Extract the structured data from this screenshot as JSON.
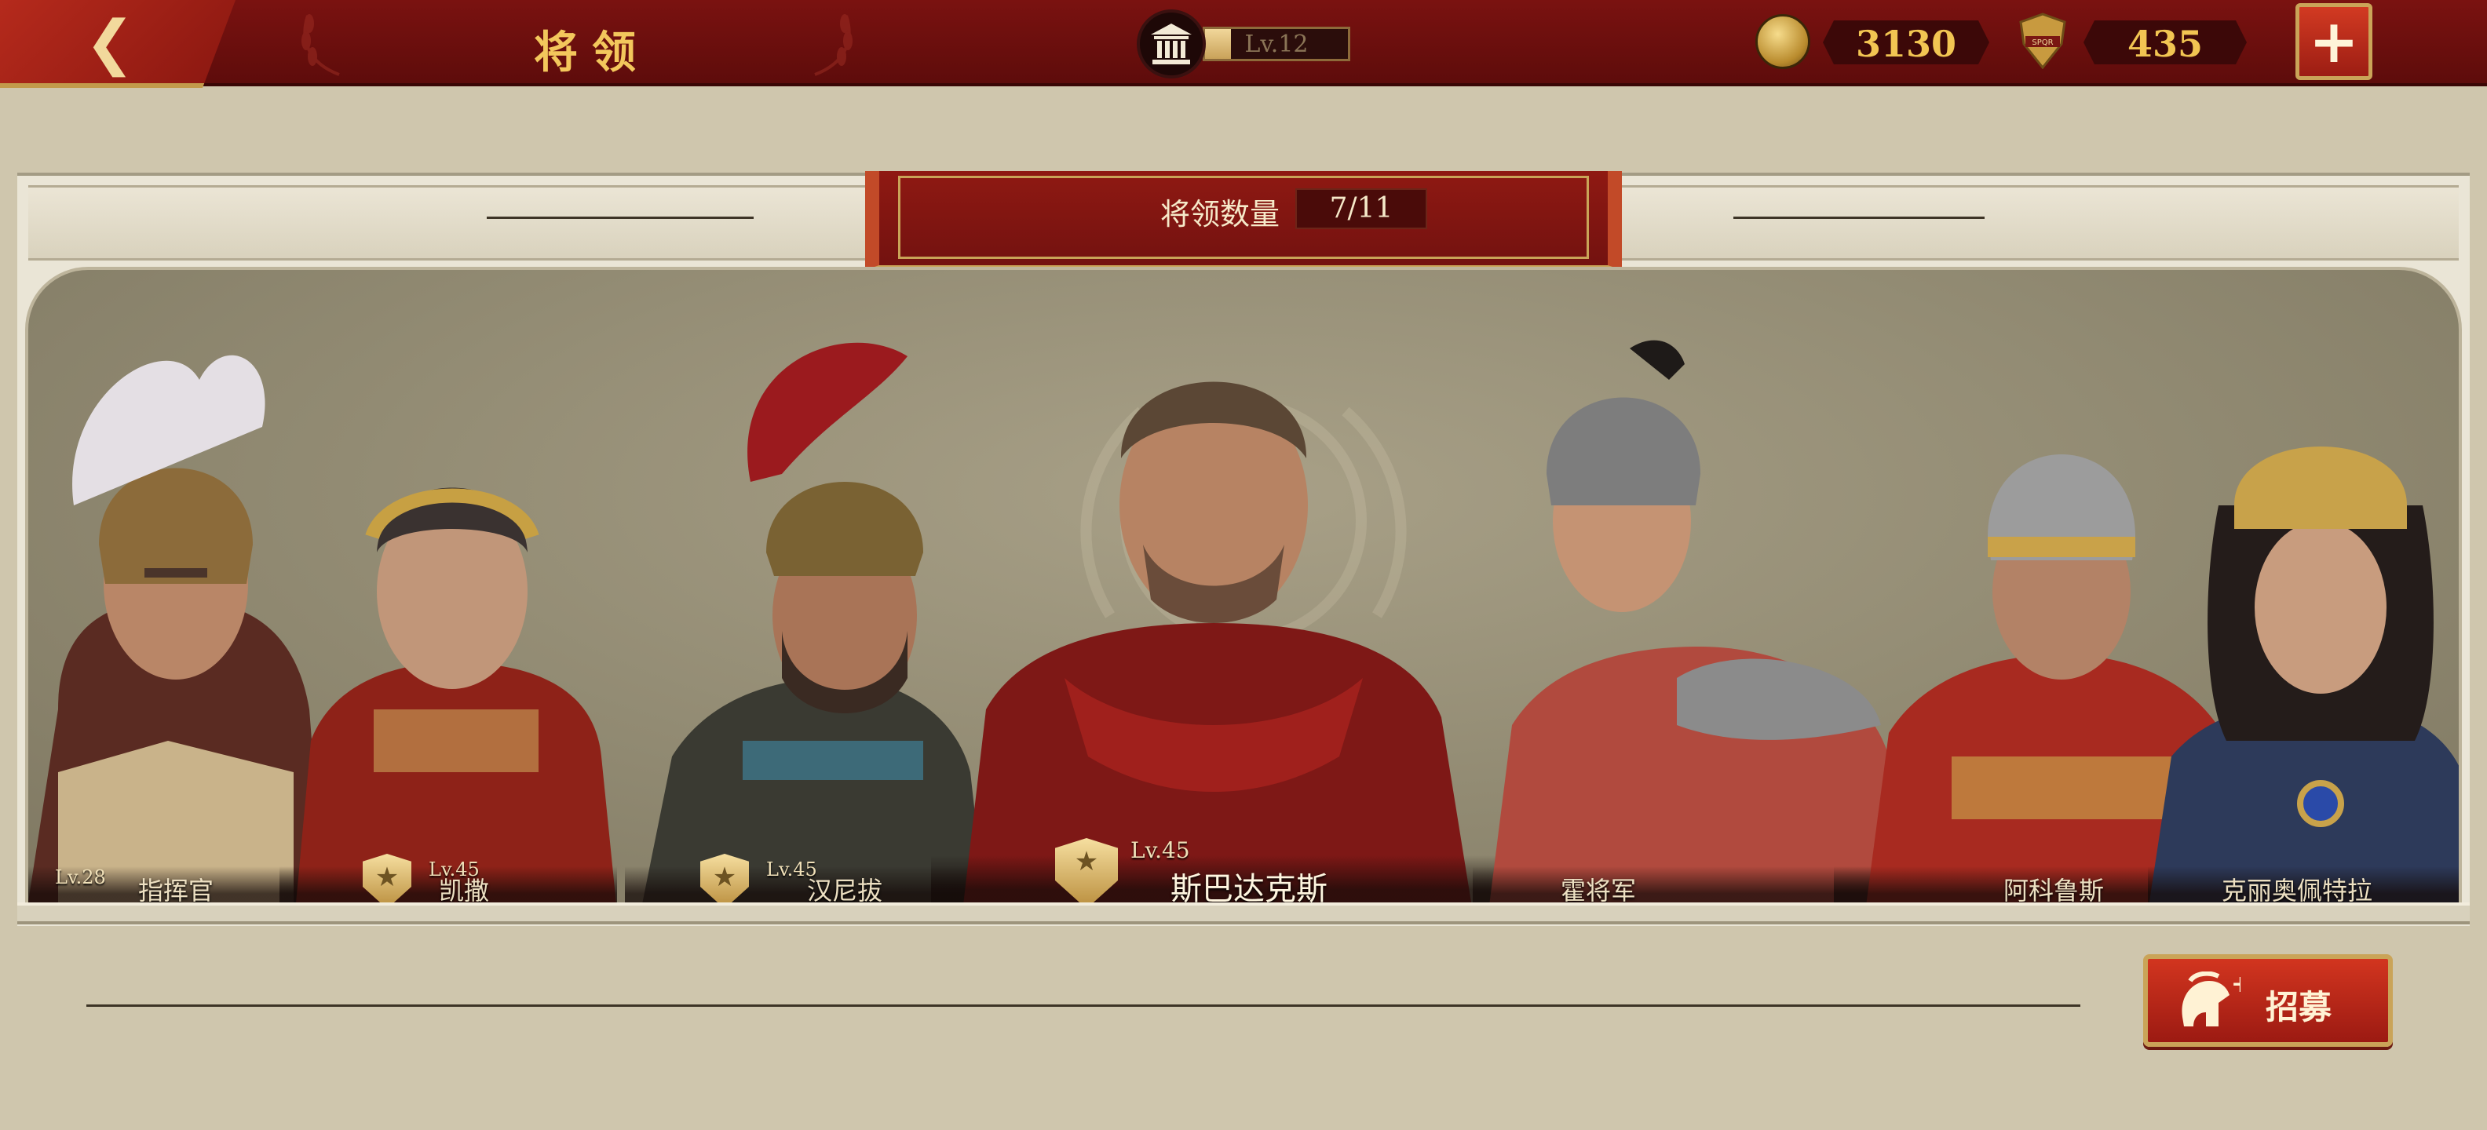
{
  "header": {
    "title": "将领",
    "level_label": "Lv.12",
    "level_progress": 0.18,
    "currencies": [
      {
        "name": "coin-icon",
        "value": "3130"
      },
      {
        "name": "spqr-icon",
        "value": "435"
      }
    ],
    "plus_symbol": "+"
  },
  "banner": {
    "label": "将领数量",
    "value": "7/11"
  },
  "generals": [
    {
      "name": "指挥官",
      "level": "Lv.28"
    },
    {
      "name": "凯撒",
      "level": "Lv.45"
    },
    {
      "name": "汉尼拔",
      "level": "Lv.45"
    },
    {
      "name": "斯巴达克斯",
      "level": "Lv.45"
    },
    {
      "name": "霍将军",
      "level": ""
    },
    {
      "name": "阿科鲁斯",
      "level": ""
    },
    {
      "name": "克丽奥佩特拉",
      "level": ""
    }
  ],
  "recruit": {
    "label": "招募",
    "plus": "+"
  },
  "colors": {
    "accent_red": "#8f1912",
    "gold": "#f2c552",
    "arena_bg": "#918a72"
  },
  "icons": [
    "back-arrow-icon",
    "building-icon",
    "coin-icon",
    "spqr-icon",
    "plus-icon",
    "shield-rank-icon",
    "spartan-helmet-icon"
  ]
}
